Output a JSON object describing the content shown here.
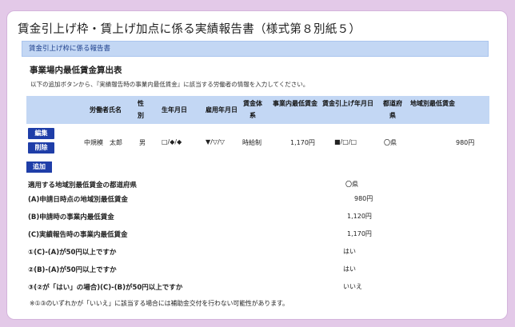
{
  "page_title": "賃金引上げ枠・賃上げ加点に係る実績報告書（様式第８別紙５）",
  "subsection_bar": "賃金引上げ枠に係る報告書",
  "section_title": "事業場内最低賃金算出表",
  "instruction": "以下の追加ボタンから、『実績報告時の事業内最低賃金』に該当する労働者の情報を入力してください。",
  "table": {
    "headers": [
      "労働者氏名",
      "性別",
      "生年月日",
      "雇用年月日",
      "賃金体系",
      "事業内最低賃金",
      "賃金引上げ年月日",
      "都道府県",
      "地域別最低賃金"
    ],
    "rows": [
      {
        "edit_label": "編集",
        "delete_label": "削除",
        "name": "中規模　太郎",
        "gender": "男",
        "birth": "□/◆/◆",
        "employ": "▼/▽/▽",
        "wage_system": "時給制",
        "min_wage": "1,170円",
        "raise_date": "■/□/□",
        "pref": "〇県",
        "regional_wage": "980円"
      }
    ]
  },
  "add_label": "追加",
  "summary": [
    {
      "label": "適用する地域別最低賃金の都道府県",
      "value": "〇県"
    },
    {
      "label": "(A)申請日時点の地域別最低賃金",
      "value": "980円"
    },
    {
      "label": "(B)申請時の事業内最低賃金",
      "value": "1,120円"
    },
    {
      "label": "(C)実績報告時の事業内最低賃金",
      "value": "1,170円"
    },
    {
      "label": "①(C)-(A)が50円以上ですか",
      "value": "はい"
    },
    {
      "label": "②(B)-(A)が50円以上ですか",
      "value": "はい"
    },
    {
      "label": "③(②が「はい」の場合)(C)-(B)が50円以上ですか",
      "value": "いいえ"
    }
  ],
  "note": "※①③のいずれかが「いいえ」に該当する場合には補助金交付を行わない可能性があります。",
  "colors": {
    "background": "#e3c9e8",
    "header_blue": "#c3d7f4",
    "button_blue": "#1f3ea8"
  }
}
